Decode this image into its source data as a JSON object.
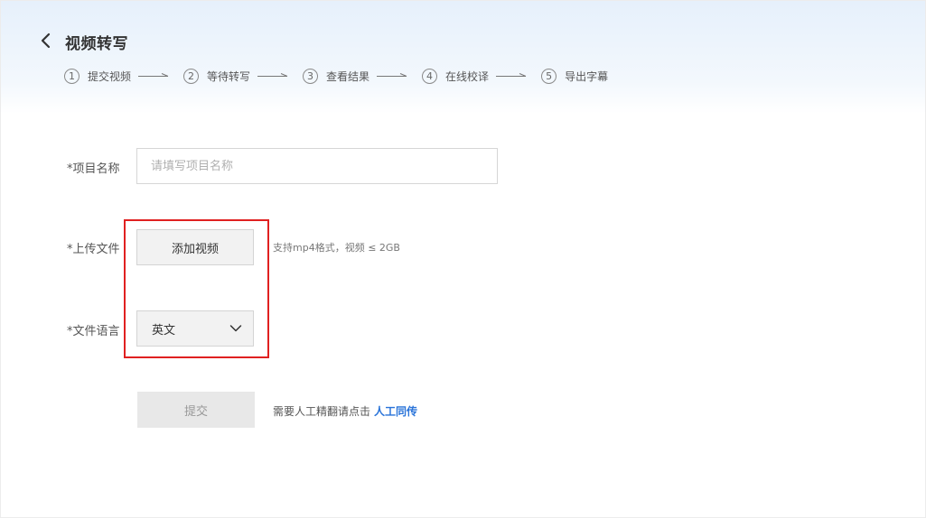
{
  "header": {
    "title": "视频转写"
  },
  "steps": [
    {
      "num": "1",
      "label": "提交视频"
    },
    {
      "num": "2",
      "label": "等待转写"
    },
    {
      "num": "3",
      "label": "查看结果"
    },
    {
      "num": "4",
      "label": "在线校译"
    },
    {
      "num": "5",
      "label": "导出字幕"
    }
  ],
  "form": {
    "project_name": {
      "label": "*项目名称",
      "value": "",
      "placeholder": "请填写项目名称"
    },
    "upload": {
      "label": "*上传文件",
      "button_label": "添加视频",
      "hint": "支持mp4格式，视频 ≤ 2GB"
    },
    "language": {
      "label": "*文件语言",
      "selected": "英文"
    }
  },
  "footer": {
    "submit_label": "提交",
    "manual_prompt": "需要人工精翻请点击",
    "manual_link": "人工同传"
  },
  "colors": {
    "highlight": "#e02020",
    "link": "#2a74d9",
    "submit_disabled_bg": "#e8e8e8"
  },
  "icons": {
    "back": "back-arrow-icon",
    "step_arrow": "right-arrow-icon",
    "dropdown": "chevron-down-icon"
  }
}
